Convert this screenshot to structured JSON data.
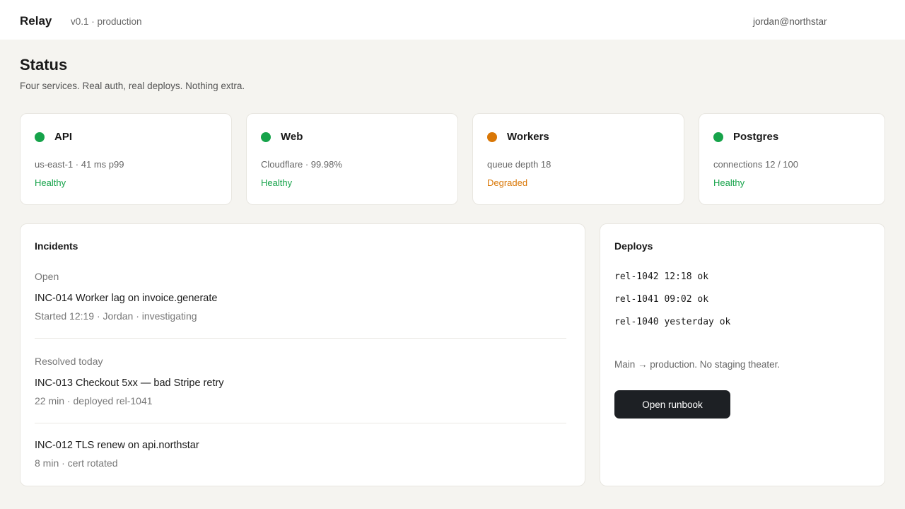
{
  "header": {
    "brand": "Relay",
    "version": "v0.1 · production",
    "user": "jordan@northstar"
  },
  "page": {
    "title": "Status",
    "subtitle": "Four services. Real auth, real deploys. Nothing extra."
  },
  "services": [
    {
      "name": "API",
      "detail": "us-east-1 · 41 ms p99",
      "state": "Healthy",
      "color": "#16a34a"
    },
    {
      "name": "Web",
      "detail": "Cloudflare · 99.98%",
      "state": "Healthy",
      "color": "#16a34a"
    },
    {
      "name": "Workers",
      "detail": "queue depth 18",
      "state": "Degraded",
      "color": "#d97706"
    },
    {
      "name": "Postgres",
      "detail": "connections 12 / 100",
      "state": "Healthy",
      "color": "#16a34a"
    }
  ],
  "incidents": {
    "title": "Incidents",
    "open_label": "Open",
    "open": [
      {
        "title": "INC-014 Worker lag on invoice.generate",
        "meta": "Started 12:19 · Jordan · investigating"
      }
    ],
    "resolved_label": "Resolved today",
    "resolved": [
      {
        "title": "INC-013 Checkout 5xx — bad Stripe retry",
        "meta": "22 min · deployed rel-1041"
      },
      {
        "title": "INC-012 TLS renew on api.northstar",
        "meta": "8 min · cert rotated"
      }
    ]
  },
  "deploys": {
    "title": "Deploys",
    "rows": [
      "rel-1042 12:18 ok",
      "rel-1041 09:02 ok",
      "rel-1040 yesterday ok"
    ],
    "note": "Main → production. No staging theater.",
    "button_label": "Open runbook"
  }
}
